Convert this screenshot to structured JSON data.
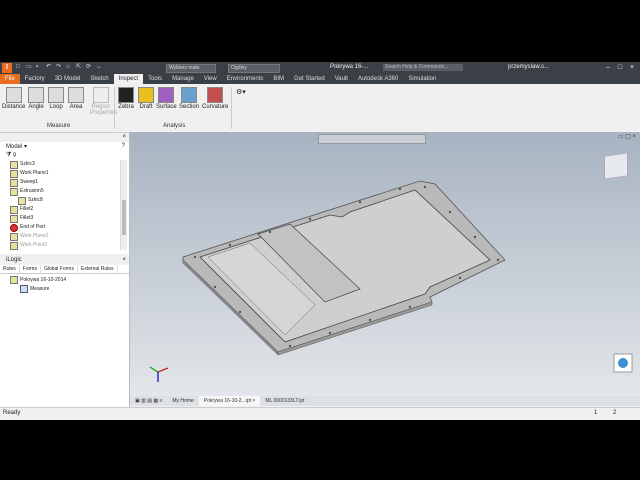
{
  "title_bar": {
    "logo": "I",
    "material_combo": "Wybierz mate",
    "appearance_combo": "Ogólny",
    "document_title": "Pokrywa 16-...",
    "search_placeholder": "Search Help & Commands...",
    "user": "przemyslaw.s..."
  },
  "ribbon_tabs": [
    "File",
    "Factory",
    "3D Model",
    "Sketch",
    "Inspect",
    "Tools",
    "Manage",
    "View",
    "Environments",
    "BIM",
    "Get Started",
    "Vault",
    "Autodesk A360",
    "Simulation"
  ],
  "ribbon": {
    "measure_group": {
      "label": "Measure",
      "buttons": [
        "Distance",
        "Angle",
        "Loop",
        "Area"
      ],
      "region_label_1": "Region",
      "region_label_2": "Properties"
    },
    "analysis_group": {
      "label": "Analysis",
      "buttons": [
        "Zebra",
        "Draft",
        "Surface",
        "Section",
        "Curvature"
      ]
    }
  },
  "browser": {
    "title": "Model",
    "items": [
      {
        "label": "Szkic3",
        "state": "normal"
      },
      {
        "label": "Work Plane1",
        "state": "normal"
      },
      {
        "label": "Sweep1",
        "state": "normal"
      },
      {
        "label": "Extrusion5",
        "state": "normal"
      },
      {
        "label": "Szkic8",
        "state": "normal"
      },
      {
        "label": "Fillet2",
        "state": "normal"
      },
      {
        "label": "Fillet3",
        "state": "normal"
      },
      {
        "label": "End of Part",
        "state": "end"
      },
      {
        "label": "Work Plane2",
        "state": "grey"
      },
      {
        "label": "Work Point2",
        "state": "grey"
      }
    ]
  },
  "ilogic": {
    "title": "iLogic",
    "tabs": [
      "Rules",
      "Forms",
      "Global Forms",
      "External Rules"
    ],
    "document": "Pokrywa 16-10-2014",
    "rule": "Measure"
  },
  "document_tabs": [
    "My Home",
    "Pokrywa 16-10-2...ipt",
    "ML 0000133LT.ipt"
  ],
  "status": {
    "text": "Ready",
    "page1": "1",
    "page2": "2"
  }
}
